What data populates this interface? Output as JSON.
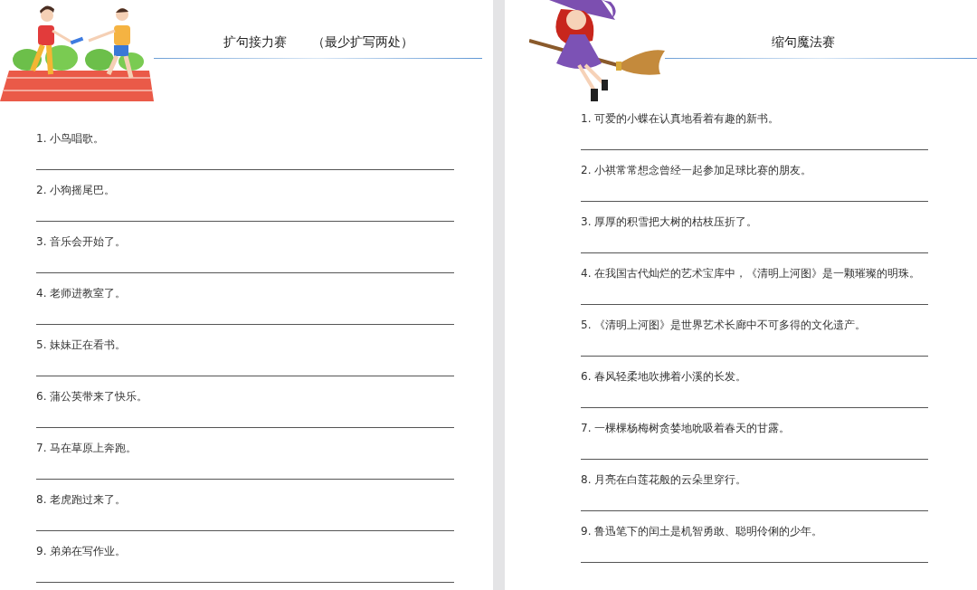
{
  "left_page": {
    "title": "扩句接力赛",
    "subtitle": "（最少扩写两处）",
    "items": [
      {
        "text": "1. 小鸟唱歌。"
      },
      {
        "text": "2. 小狗摇尾巴。"
      },
      {
        "text": "3. 音乐会开始了。"
      },
      {
        "text": "4. 老师进教室了。"
      },
      {
        "text": "5. 妹妹正在看书。"
      },
      {
        "text": "6. 蒲公英带来了快乐。"
      },
      {
        "text": "7. 马在草原上奔跑。"
      },
      {
        "text": "8. 老虎跑过来了。"
      },
      {
        "text": "9. 弟弟在写作业。"
      }
    ]
  },
  "right_page": {
    "title": "缩句魔法赛",
    "items": [
      {
        "text": "1. 可爱的小蝶在认真地看着有趣的新书。"
      },
      {
        "text": "2. 小祺常常想念曾经一起参加足球比赛的朋友。"
      },
      {
        "text": "3. 厚厚的积雪把大树的枯枝压折了。"
      },
      {
        "text": "4. 在我国古代灿烂的艺术宝库中，《清明上河图》是一颗璀璨的明珠。"
      },
      {
        "text": "5. 《清明上河图》是世界艺术长廊中不可多得的文化遗产。"
      },
      {
        "text": "6. 春风轻柔地吹拂着小溪的长发。"
      },
      {
        "text": "7. 一棵棵杨梅树贪婪地吮吸着春天的甘露。"
      },
      {
        "text": "8. 月亮在白莲花般的云朵里穿行。"
      },
      {
        "text": "9. 鲁迅笔下的闰土是机智勇敢、聪明伶俐的少年。"
      }
    ]
  }
}
